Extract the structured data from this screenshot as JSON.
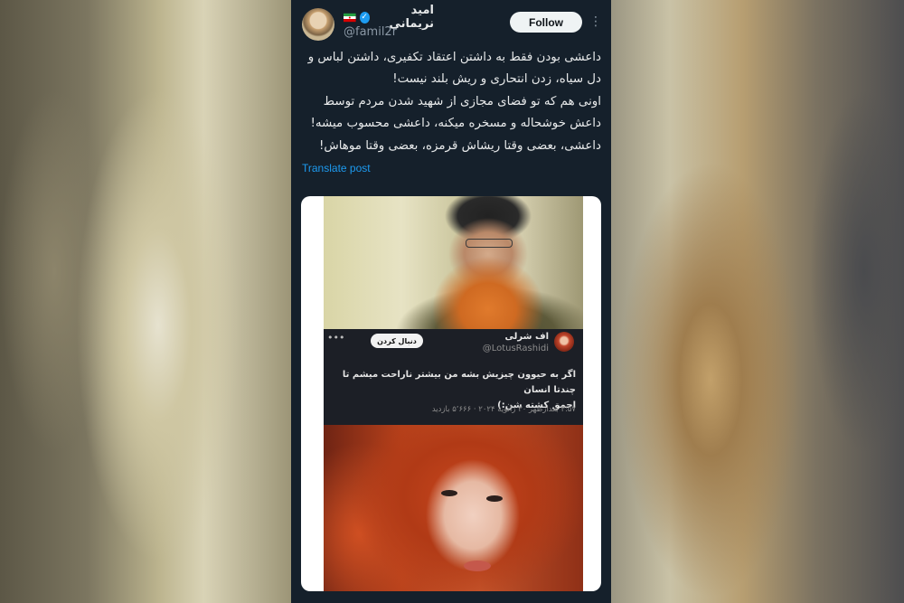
{
  "post": {
    "author": {
      "display_name": "امید نریمانی",
      "handle": "@famil2r",
      "verified": true,
      "flag_icon": "iran-flag-icon"
    },
    "follow_label": "Follow",
    "more_icon": "ellipsis-vertical-icon",
    "text_lines": [
      "داعشی بودن فقط به داشتن اعتقاد تکفیری، داشتن لباس و",
      "دل سیاه، زدن انتحاری و ریش بلند نیست!",
      "اونی هم که تو فضای مجازی از شهید شدن مردم توسط",
      "داعش خوشحاله و مسخره میکنه، داعشی محسوب میشه!",
      "داعشی، بعضی وقتا ریشاش قرمزه، بعضی وقتا موهاش!"
    ],
    "translate_label": "Translate post"
  },
  "embedded_screenshot": {
    "name": "اف شرلی",
    "handle": "@LotusRashidi",
    "follow_label": "دنبال کردن",
    "text_lines": [
      "اگر به حیوون چیزیش بشه من بیشتر ناراحت میشم تا چندتا انسان",
      "احمق کشته شن:)"
    ],
    "meta": "۳:۵۷ بعدازظهر ۳۰ ژانویهٔ ۲۰۲۴ · ۵٬۶۶۶ بازدید"
  },
  "colors": {
    "background": "#15202b",
    "text": "#e7e9ea",
    "secondary": "#8b98a5",
    "link": "#1d9bf0",
    "follow_button": "#eff3f4"
  }
}
